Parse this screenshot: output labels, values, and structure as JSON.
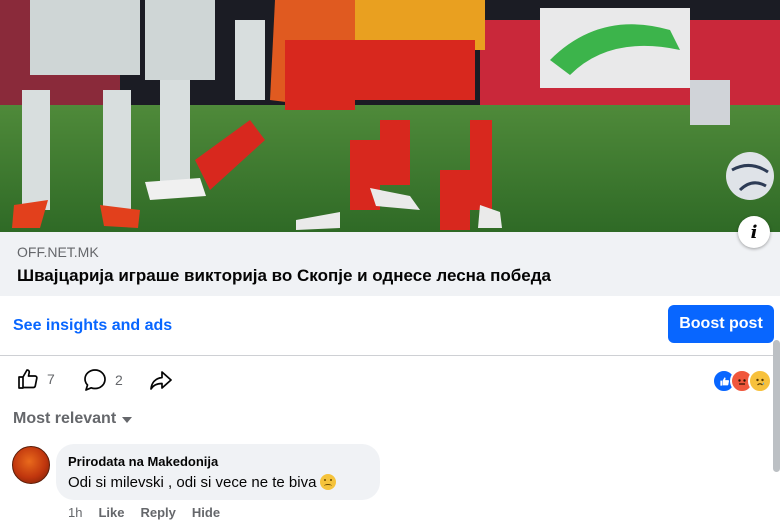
{
  "link_preview": {
    "domain": "OFF.NET.MK",
    "headline": "Швајцарија играше викторија во Скопје и однесе лесна победа",
    "info_icon": "info-icon"
  },
  "insights": {
    "link_label": "See insights and ads",
    "boost_label": "Boost post",
    "accent": "#0866ff"
  },
  "actions": {
    "like_count": "7",
    "comment_count": "2",
    "like_icon": "thumbs-up-icon",
    "comment_icon": "comment-icon",
    "share_icon": "share-icon",
    "reactions": [
      "like-reaction",
      "angry-reaction",
      "sad-reaction"
    ]
  },
  "comments": {
    "sort_label": "Most relevant",
    "items": [
      {
        "author": "Prirodata na Makedonija",
        "text": "Odi si milevski , odi si vece ne te biva",
        "emoji": "wink-emoji",
        "time": "1h",
        "like_label": "Like",
        "reply_label": "Reply",
        "hide_label": "Hide"
      }
    ]
  }
}
